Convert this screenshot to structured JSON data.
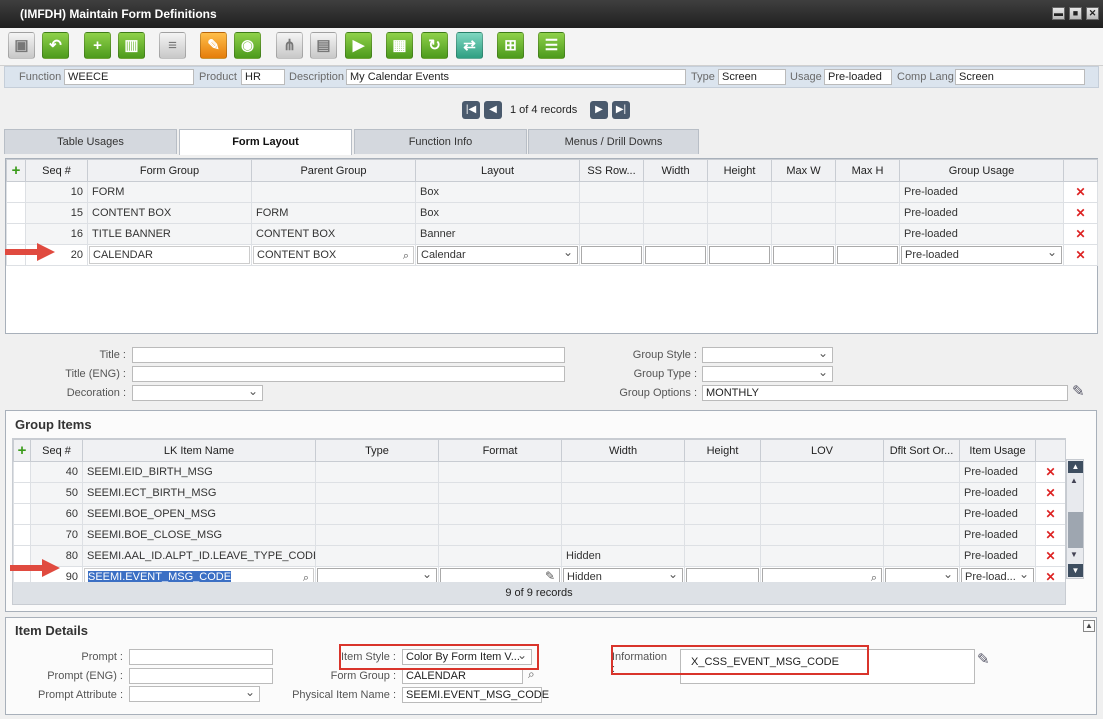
{
  "window": {
    "title": "(IMFDH) Maintain Form Definitions"
  },
  "header": {
    "function_label": "Function",
    "function_value": "WEECE",
    "product_label": "Product",
    "product_value": "HR",
    "description_label": "Description",
    "description_value": "My Calendar Events",
    "type_label": "Type",
    "type_value": "Screen",
    "usage_label": "Usage",
    "usage_value": "Pre-loaded",
    "complang_label": "Comp Lang",
    "complang_value": "Screen"
  },
  "pager": {
    "text": "1 of 4 records"
  },
  "tabs": [
    {
      "label": "Table Usages"
    },
    {
      "label": "Form Layout"
    },
    {
      "label": "Function Info"
    },
    {
      "label": "Menus / Drill Downs"
    }
  ],
  "form_groups": {
    "columns": [
      "Seq #",
      "Form Group",
      "Parent Group",
      "Layout",
      "SS Row...",
      "Width",
      "Height",
      "Max W",
      "Max H",
      "Group Usage"
    ],
    "rows": [
      {
        "seq": "10",
        "group": "FORM",
        "parent": "",
        "layout": "Box",
        "usage": "Pre-loaded"
      },
      {
        "seq": "15",
        "group": "CONTENT BOX",
        "parent": "FORM",
        "layout": "Box",
        "usage": "Pre-loaded"
      },
      {
        "seq": "16",
        "group": "TITLE BANNER",
        "parent": "CONTENT BOX",
        "layout": "Banner",
        "usage": "Pre-loaded"
      },
      {
        "seq": "20",
        "group": "CALENDAR",
        "parent": "CONTENT BOX",
        "layout": "Calendar",
        "usage": "Pre-loaded"
      }
    ]
  },
  "group_props": {
    "title_label": "Title :",
    "title_eng_label": "Title  (ENG) :",
    "decoration_label": "Decoration :",
    "group_style_label": "Group Style :",
    "group_type_label": "Group Type :",
    "group_options_label": "Group Options :",
    "group_options_value": "MONTHLY"
  },
  "group_items": {
    "title": "Group Items",
    "columns": [
      "Seq #",
      "LK Item Name",
      "Type",
      "Format",
      "Width",
      "Height",
      "LOV",
      "Dflt Sort Or...",
      "Item Usage"
    ],
    "rows": [
      {
        "seq": "40",
        "name": "SEEMI.EID_BIRTH_MSG",
        "width": "",
        "usage": "Pre-loaded"
      },
      {
        "seq": "50",
        "name": "SEEMI.ECT_BIRTH_MSG",
        "width": "",
        "usage": "Pre-loaded"
      },
      {
        "seq": "60",
        "name": "SEEMI.BOE_OPEN_MSG",
        "width": "",
        "usage": "Pre-loaded"
      },
      {
        "seq": "70",
        "name": "SEEMI.BOE_CLOSE_MSG",
        "width": "",
        "usage": "Pre-loaded"
      },
      {
        "seq": "80",
        "name": "SEEMI.AAL_ID.ALPT_ID.LEAVE_TYPE_CODE",
        "width": "Hidden",
        "usage": "Pre-loaded"
      },
      {
        "seq": "90",
        "name": "SEEMI.EVENT_MSG_CODE",
        "width": "Hidden",
        "usage": "Pre-load..."
      }
    ],
    "footer": "9 of 9 records"
  },
  "item_details": {
    "title": "Item Details",
    "prompt_label": "Prompt :",
    "prompt_eng_label": "Prompt  (ENG) :",
    "prompt_attr_label": "Prompt Attribute :",
    "item_style_label": "Item Style :",
    "item_style_value": "Color By Form Item V...",
    "form_group_label": "Form Group :",
    "form_group_value": "CALENDAR",
    "physical_label": "Physical Item Name :",
    "physical_value": "SEEMI.EVENT_MSG_CODE",
    "information_label": "Information :",
    "information_value": "X_CSS_EVENT_MSG_CODE"
  },
  "colors": {
    "arrow": "#e04a3f",
    "highlight": "#d9342b",
    "accent_green": "#4c9a1c",
    "delete": "#d22"
  }
}
